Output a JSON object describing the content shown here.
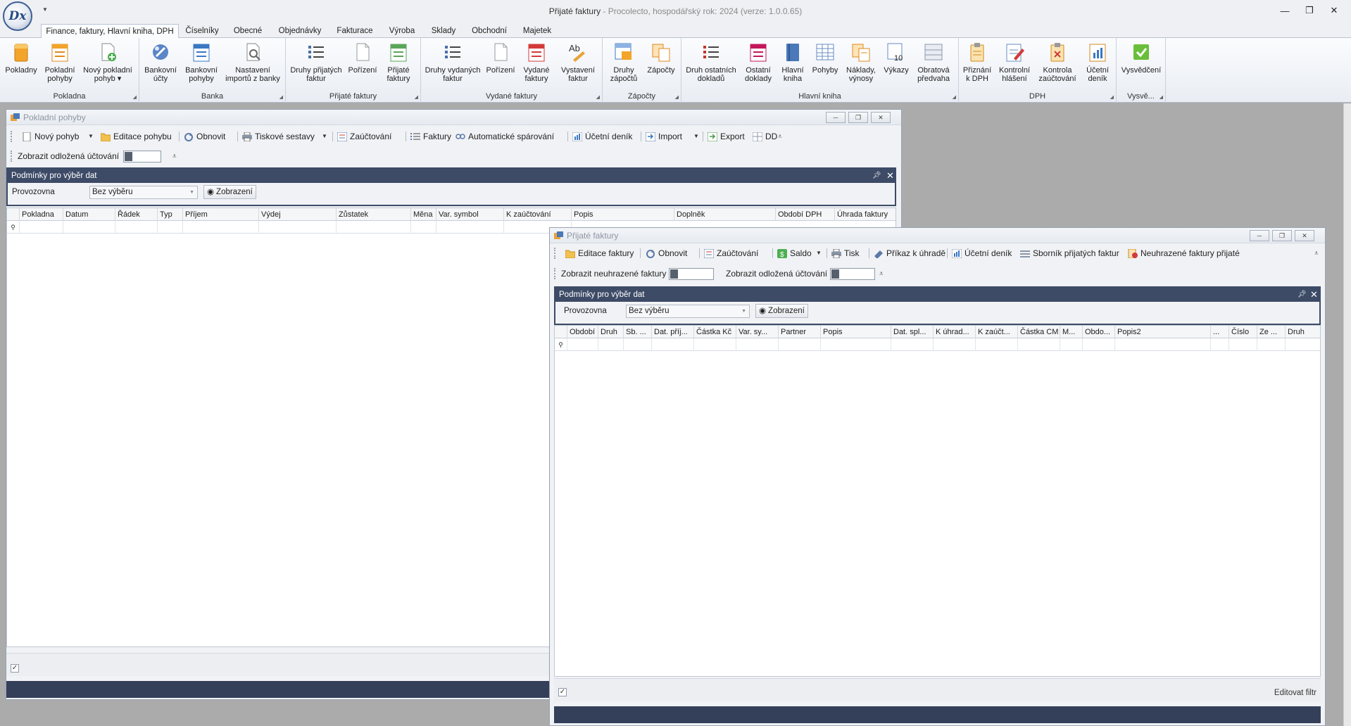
{
  "app": {
    "logo_text": "Dx",
    "title": "Přijaté faktury",
    "subtitle": " - Procolecto, hospodářský rok: 2024 (verze: 1.0.0.65)"
  },
  "ribbon": {
    "tabs": [
      "Finance, faktury, Hlavní kniha, DPH",
      "Číselníky",
      "Obecné",
      "Objednávky",
      "Fakturace",
      "Výroba",
      "Sklady",
      "Obchodní",
      "Majetek"
    ],
    "groups": [
      {
        "label": "Pokladna",
        "buttons": [
          "Pokladny",
          "Pokladní\npohyby",
          "Nový pokladní\npohyb ▾"
        ]
      },
      {
        "label": "Banka",
        "buttons": [
          "Bankovní\núčty",
          "Bankovní\npohyby",
          "Nastavení\nimportů z banky"
        ]
      },
      {
        "label": "Přijaté faktury",
        "buttons": [
          "Druhy přijatých\nfaktur",
          "Pořízení",
          "Přijaté\nfaktury"
        ]
      },
      {
        "label": "Vydané faktury",
        "buttons": [
          "Druhy vydaných\nfaktur",
          "Pořízení",
          "Vydané\nfaktury",
          "Vystavení\nfaktur"
        ]
      },
      {
        "label": "Zápočty",
        "buttons": [
          "Druhy\nzápočtů",
          "Zápočty"
        ]
      },
      {
        "label": "Hlavní kniha",
        "buttons": [
          "Druh ostatních\ndokladů",
          "Ostatní\ndoklady",
          "Hlavní\nkniha",
          "Pohyby",
          "Náklady,\nvýnosy",
          "Výkazy",
          "Obratová\npředvaha"
        ]
      },
      {
        "label": "DPH",
        "buttons": [
          "Přiznání\nk DPH",
          "Kontrolní\nhlášení",
          "Kontrola\nzaúčtování",
          "Účetní\ndeník"
        ]
      },
      {
        "label": "Vysvě...",
        "buttons": [
          "Vysvědčení"
        ]
      }
    ]
  },
  "win1": {
    "title": "Pokladní pohyby",
    "toolbar": [
      "Nový pohyb",
      "Editace pohybu",
      "Obnovit",
      "Tiskové sestavy",
      "Zaúčtování",
      "Faktury",
      "Automatické spárování",
      "Účetní deník",
      "Import",
      "Export",
      "DD"
    ],
    "toggle_label": "Zobrazit odložená účtování",
    "panel_title": "Podmínky pro výběr dat",
    "filter_label": "Provozovna",
    "filter_value": "Bez výběru",
    "filter_button": "Zobrazení",
    "columns": [
      "Pokladna",
      "Datum",
      "Řádek",
      "Typ",
      "Příjem",
      "Výdej",
      "Zůstatek",
      "Měna",
      "Var. symbol",
      "K zaúčtování",
      "Popis",
      "Doplněk",
      "Období DPH",
      "Úhrada faktury"
    ]
  },
  "win2": {
    "title": "Přijaté faktury",
    "toolbar": [
      "Editace faktury",
      "Obnovit",
      "Zaúčtování",
      "Saldo",
      "Tisk",
      "Příkaz k úhradě",
      "Účetní deník",
      "Sborník přijatých faktur",
      "Neuhrazené faktury přijaté"
    ],
    "toggle_unpaid_label": "Zobrazit neuhrazené faktury",
    "toggle_deferred_label": "Zobrazit odložená účtování",
    "panel_title": "Podmínky pro výběr dat",
    "filter_label": "Provozovna",
    "filter_value": "Bez výběru",
    "filter_button": "Zobrazení",
    "columns": [
      "Období",
      "Druh",
      "Sb. ...",
      "Dat. příj...",
      "Částka Kč",
      "Var. sy...",
      "Partner",
      "Popis",
      "Dat. spl...",
      "K úhrad...",
      "K zaúčt...",
      "Částka CM",
      "M...",
      "Obdo...",
      "Popis2",
      "...",
      "Číslo",
      "Ze ...",
      "Druh"
    ],
    "edit_filter": "Editovat filtr"
  }
}
